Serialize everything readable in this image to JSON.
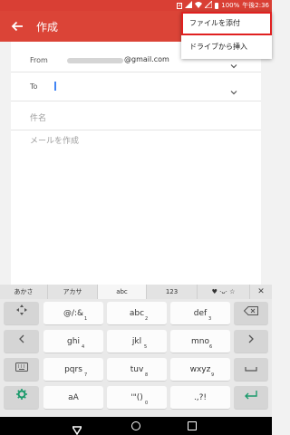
{
  "status": {
    "battery": "100%",
    "time": "午後2:36"
  },
  "appbar": {
    "title": "作成"
  },
  "compose": {
    "from_label": "From",
    "from_domain": "@gmail.com",
    "to_label": "To",
    "subject_placeholder": "件名",
    "body_placeholder": "メールを作成"
  },
  "menu": {
    "items": [
      "ファイルを添付",
      "ドライブから挿入"
    ]
  },
  "keyboard": {
    "tabs": [
      "あかさ",
      "アカサ",
      "abc",
      "123",
      "♥ ·ᴗ· ☆"
    ],
    "close": "✕",
    "keys": {
      "k1": "@/:&",
      "k1s": "1",
      "k2": "abc",
      "k2s": "2",
      "k3": "def",
      "k3s": "3",
      "k4": "ghi",
      "k4s": "4",
      "k5": "jkl",
      "k5s": "5",
      "k6": "mno",
      "k6s": "6",
      "k7": "pqrs",
      "k7s": "7",
      "k8": "tuv",
      "k8s": "8",
      "k9": "wxyz",
      "k9s": "9",
      "k10": "aA",
      "k11": "'\"()",
      "k11s": "0",
      "k12": ".,?!"
    }
  },
  "colors": {
    "appbar": "#db4437",
    "accent_green": "#1a9a6b",
    "highlight_red": "#e02020"
  }
}
